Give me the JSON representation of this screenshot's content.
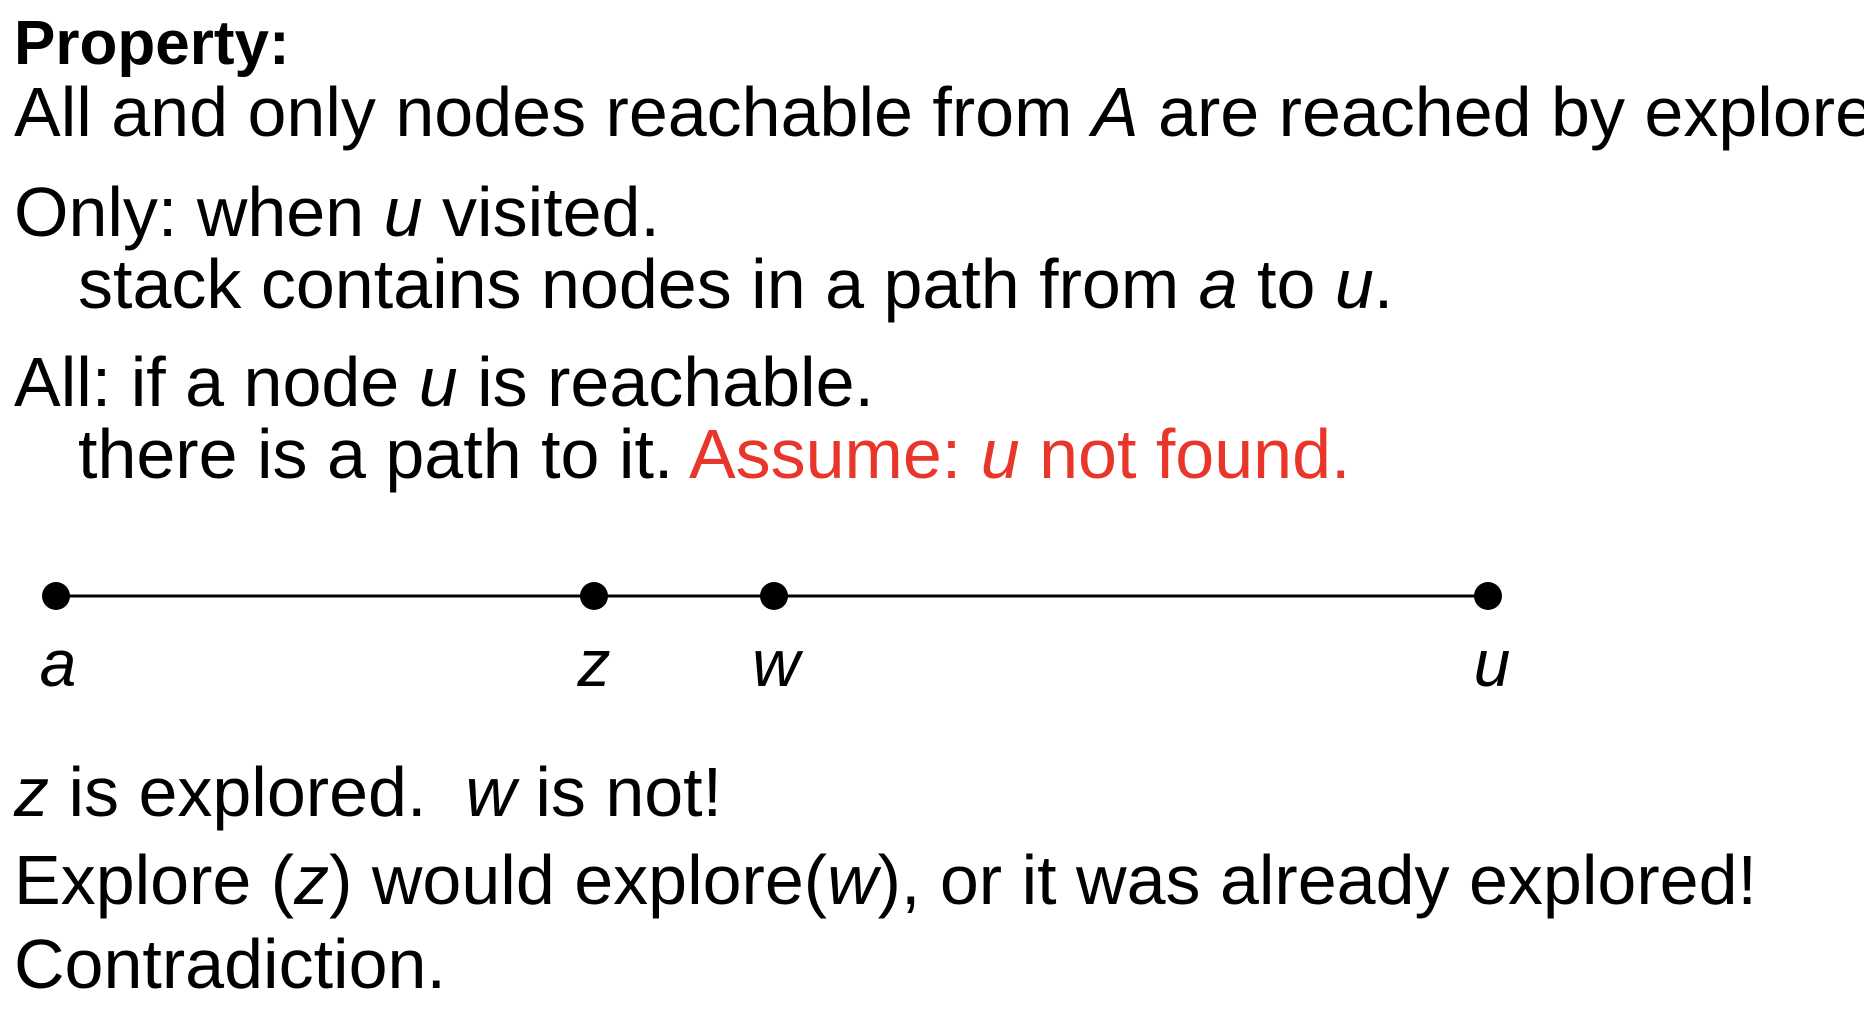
{
  "heading": "Property:",
  "statement": {
    "pre": "All and only nodes reachable from ",
    "var": "A",
    "post": " are reached by explore."
  },
  "only_case": {
    "line1_pre": "Only: when ",
    "line1_var": "u",
    "line1_post": " visited.",
    "line2_pre": "stack contains nodes in a path from ",
    "line2_var1": "a",
    "line2_mid": " to ",
    "line2_var2": "u",
    "line2_post": "."
  },
  "all_case": {
    "line1_pre": "All: if a node ",
    "line1_var": "u",
    "line1_post": " is reachable.",
    "line2": "there is a path to it. ",
    "assume_pre": "Assume: ",
    "assume_var": "u",
    "assume_post": " not found."
  },
  "path_nodes": [
    "a",
    "z",
    "w",
    "u"
  ],
  "conclusion": {
    "line1_var1": "z",
    "line1_mid": " is explored.  ",
    "line1_var2": "w",
    "line1_post": " is not!",
    "line2_pre": "Explore (",
    "line2_var1": "z",
    "line2_mid": ") would explore(",
    "line2_var2": "w",
    "line2_post": "), or it was already explored!",
    "line3": "Contradiction."
  },
  "colors": {
    "text": "#000000",
    "highlight": "#e8362a"
  }
}
